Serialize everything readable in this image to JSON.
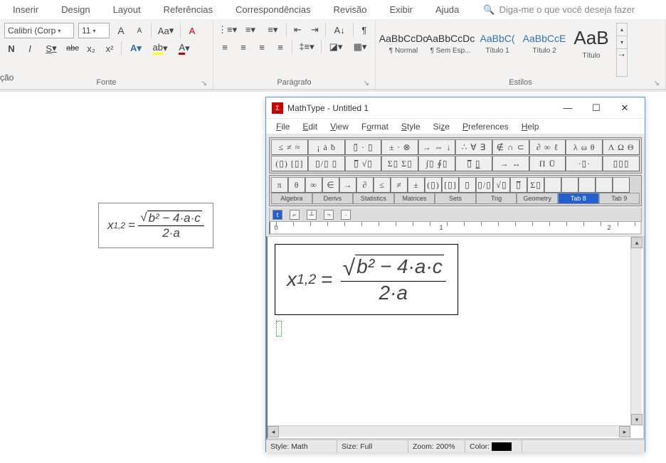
{
  "ribbon": {
    "tabs": [
      "Inserir",
      "Design",
      "Layout",
      "Referências",
      "Correspondências",
      "Revisão",
      "Exibir",
      "Ajuda"
    ],
    "search_placeholder": "Diga-me o que você deseja fazer"
  },
  "font_group": {
    "label": "Fonte",
    "font_name": "Calibri (Corp",
    "font_size": "11",
    "grow": "A",
    "shrink": "A",
    "change_case": "Aa",
    "clear": "A",
    "bold": "N",
    "italic": "I",
    "underline": "S",
    "strike": "abc",
    "sub": "x₂",
    "sup": "x²"
  },
  "para_group": {
    "label": "Parágrafo",
    "pilcrow": "¶"
  },
  "styles_group": {
    "label": "Estilos",
    "items": [
      {
        "preview": "AaBbCcDc",
        "name": "¶ Normal"
      },
      {
        "preview": "AaBbCcDc",
        "name": "¶ Sem Esp..."
      },
      {
        "preview": "AaBbC(",
        "name": "Título 1"
      },
      {
        "preview": "AaBbCcE",
        "name": "Título 2"
      },
      {
        "preview": "AaB",
        "name": "Título"
      }
    ]
  },
  "left_fragment": "ção",
  "doc_equation": {
    "lhs": "x",
    "sub": "1,2",
    "eq": "=",
    "num_inner": "b² − 4·a·c",
    "den": "2·a"
  },
  "mathtype": {
    "title": "MathType - Untitled 1",
    "menu": [
      "File",
      "Edit",
      "View",
      "Format",
      "Style",
      "Size",
      "Preferences",
      "Help"
    ],
    "palette_row1": [
      "≤ ≠ ≈",
      "¡ ȧ ḃ",
      "▯̈ · ▯",
      "± ∙ ⊗",
      "→ ⇔ ↓",
      "∴ ∀ ∃",
      "∉ ∩ ⊂",
      "∂ ∞ ℓ",
      "λ ω θ",
      "Λ Ω Θ"
    ],
    "palette_row2": [
      "(▯) [▯]",
      "▯/▯ ▯",
      "▯̅ √▯",
      "Σ▯ Σ▯",
      "∫▯ ∮▯",
      "▯̅ ▯̲",
      "→ ↔",
      "Π Ū",
      "·▯·",
      "▯▯▯"
    ],
    "small_row": [
      "π",
      "θ",
      "∞",
      "∈",
      "→",
      "∂",
      "≤",
      "≠",
      "±",
      "(▯)",
      "[▯]",
      "▯",
      "▯/▯",
      "√▯",
      "▯̅",
      "Σ▯",
      "",
      "",
      "",
      "",
      ""
    ],
    "template_tabs": [
      "Algebra",
      "Derivs",
      "Statistics",
      "Matrices",
      "Sets",
      "Trig",
      "Geometry",
      "Tab 8",
      "Tab 9"
    ],
    "active_tab_index": 7,
    "ruler_marks": [
      "0",
      "1",
      "2"
    ],
    "equation": {
      "lhs": "x",
      "sub": "1,2",
      "eq": "=",
      "num_inner": "b² − 4·a·c",
      "den": "2·a"
    },
    "status": {
      "style_label": "Style:",
      "style_value": "Math",
      "size_label": "Size:",
      "size_value": "Full",
      "zoom_label": "Zoom:",
      "zoom_value": "200%",
      "color_label": "Color:"
    }
  }
}
